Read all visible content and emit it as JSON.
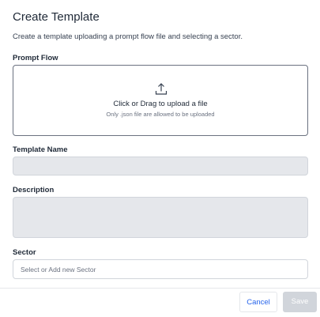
{
  "dialog": {
    "title": "Create Template",
    "subtitle": "Create a template uploading a prompt flow file and selecting a sector."
  },
  "prompt_flow": {
    "label": "Prompt Flow",
    "upload_text": "Click or Drag to upload a file",
    "upload_hint": "Only .json file are allowed to be uploaded",
    "icon": "upload-icon"
  },
  "template_name": {
    "label": "Template Name",
    "value": ""
  },
  "description": {
    "label": "Description",
    "value": ""
  },
  "sector": {
    "label": "Sector",
    "placeholder": "Select or Add new Sector"
  },
  "footer": {
    "cancel_label": "Cancel",
    "save_label": "Save"
  },
  "colors": {
    "accent": "#2563eb",
    "disabled_button": "#d1d5db",
    "input_fill": "#e5e7eb"
  }
}
